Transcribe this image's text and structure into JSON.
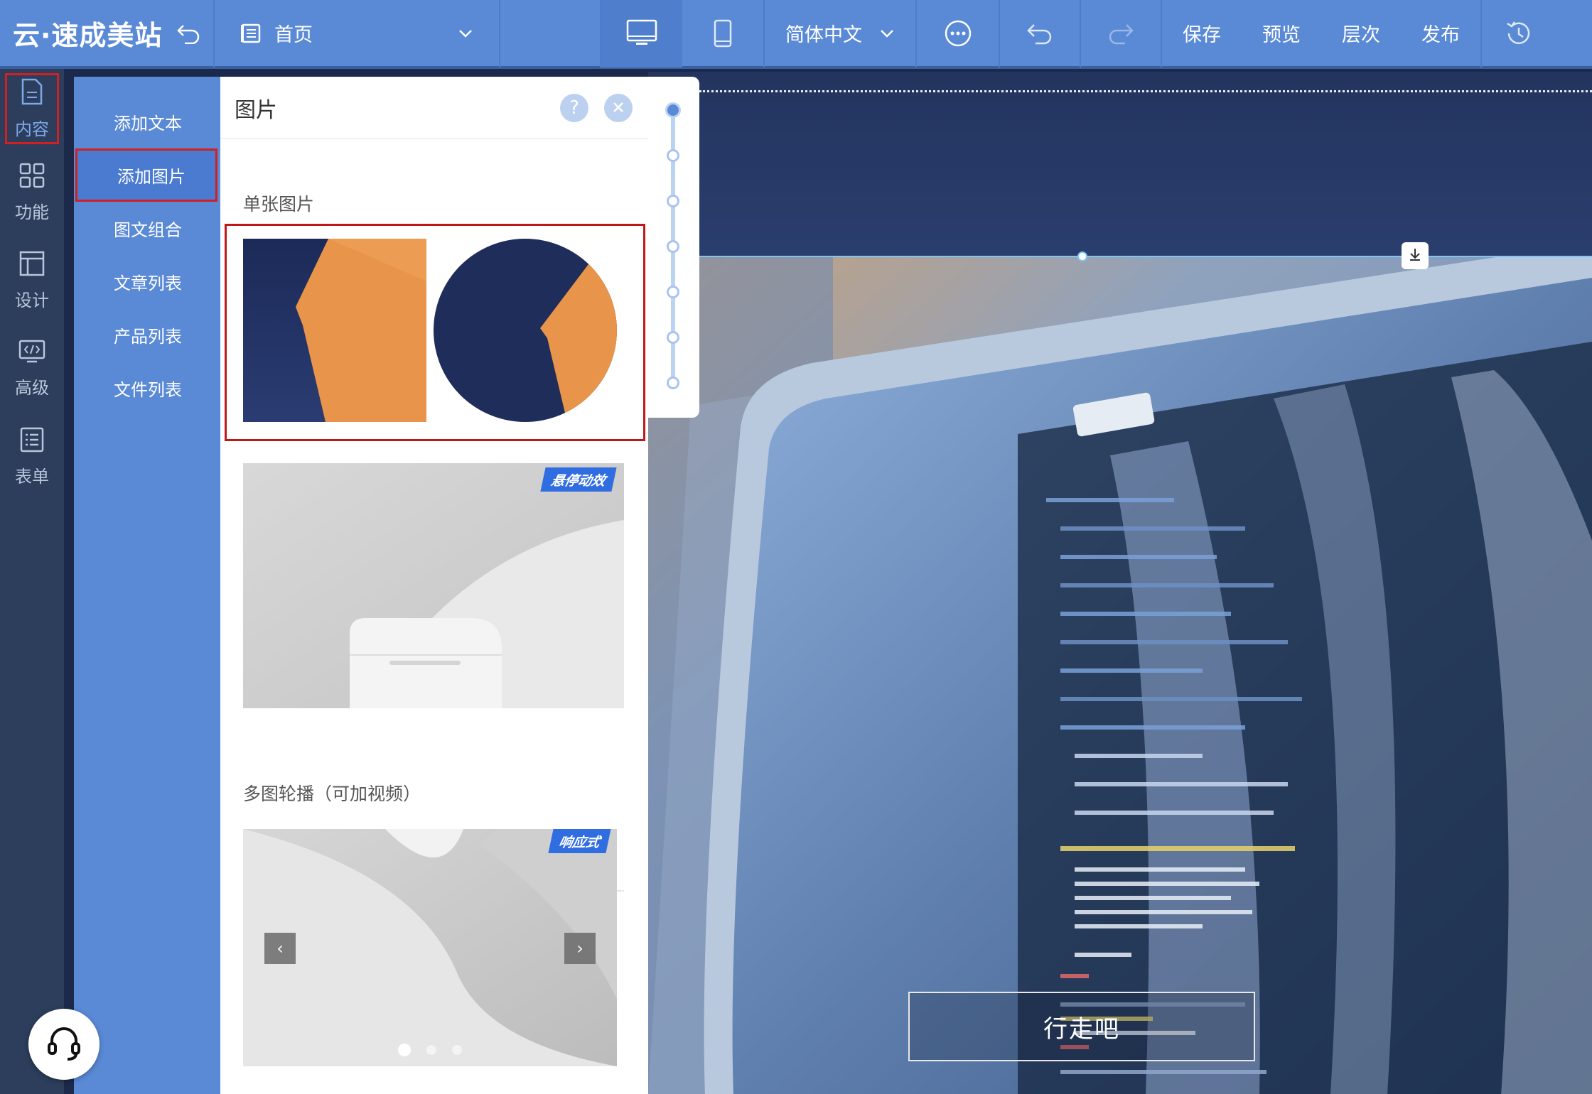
{
  "app": {
    "logo": "云·速成美站"
  },
  "topbar": {
    "page_name": "首页",
    "language": "简体中文",
    "save": "保存",
    "preview": "预览",
    "layers": "层次",
    "publish": "发布"
  },
  "rail": {
    "items": [
      {
        "label": "内容",
        "icon": "document-icon",
        "active": true
      },
      {
        "label": "功能",
        "icon": "grid-icon"
      },
      {
        "label": "设计",
        "icon": "layout-icon"
      },
      {
        "label": "高级",
        "icon": "code-icon"
      },
      {
        "label": "表单",
        "icon": "list-icon"
      }
    ]
  },
  "submenu": {
    "items": [
      {
        "label": "添加文本"
      },
      {
        "label": "添加图片",
        "active": true
      },
      {
        "label": "图文组合"
      },
      {
        "label": "文章列表"
      },
      {
        "label": "产品列表"
      },
      {
        "label": "文件列表"
      }
    ]
  },
  "panel": {
    "title": "图片",
    "help": "?",
    "single_section": "单张图片",
    "hover_tag": "悬停动效",
    "carousel_section": "多图轮播（可加视频）",
    "carousel_tag": "响应式",
    "carousel_slides": 3,
    "carousel_active_slide": 1
  },
  "canvas": {
    "cta_label": "行走吧"
  },
  "colors": {
    "topbar": "#5a8ad6",
    "rail": "#2c3e5c",
    "highlight_border": "#d02020",
    "tag": "#2f6de0",
    "orange": "#e8944a",
    "navy": "#1f2d5a"
  }
}
